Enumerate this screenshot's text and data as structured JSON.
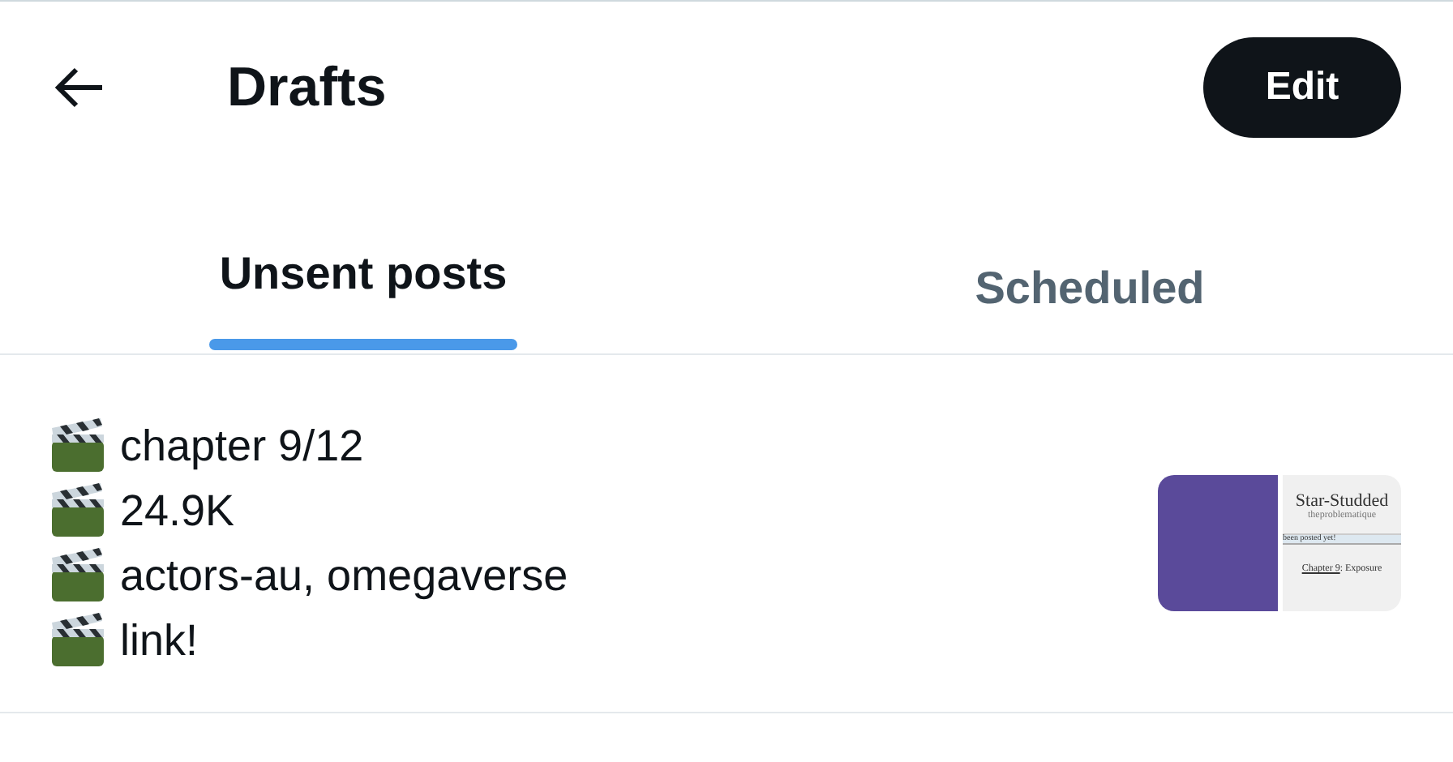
{
  "header": {
    "title": "Drafts",
    "edit_button": "Edit"
  },
  "tabs": [
    {
      "label": "Unsent posts",
      "selected": true
    },
    {
      "label": "Scheduled",
      "selected": false
    }
  ],
  "drafts": [
    {
      "lines": [
        "chapter 9/12",
        "24.9K",
        "actors-au, omegaverse",
        "link!"
      ],
      "attachment": {
        "doc_title": "Star-Studded",
        "doc_author": "theproblematique",
        "doc_note": "been posted yet!",
        "doc_link": "Chapter 9",
        "doc_chapter": ": Exposure"
      }
    }
  ]
}
